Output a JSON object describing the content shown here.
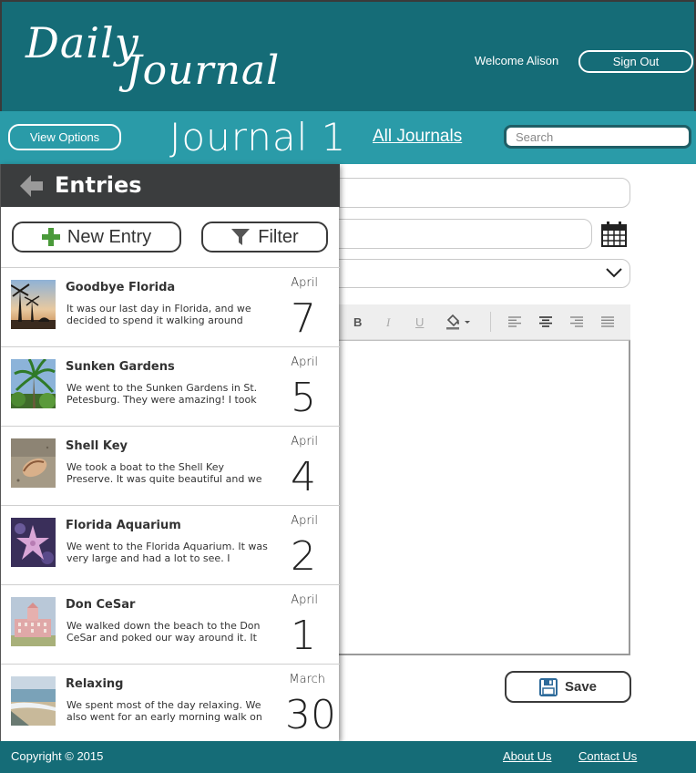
{
  "header": {
    "logo_line1": "Daily",
    "logo_line2": "Journal",
    "welcome": "Welcome Alison",
    "sign_out": "Sign Out"
  },
  "subbar": {
    "view_options": "View Options",
    "journal_title": "Journal 1",
    "all_journals": "All Journals",
    "search_placeholder": "Search"
  },
  "panel": {
    "title": "Entries",
    "new_entry": "New Entry",
    "filter": "Filter"
  },
  "entries": [
    {
      "title": "Goodbye Florida",
      "text": "It was our last day in Florida, and we decided to spend it walking around",
      "month": "April",
      "day": "7",
      "thumb": "palm-sunset"
    },
    {
      "title": "Sunken Gardens",
      "text": "We went to the Sunken Gardens in St. Petesburg. They were amazing! I took",
      "month": "April",
      "day": "5",
      "thumb": "palm-garden"
    },
    {
      "title": "Shell Key",
      "text": "We took a boat to the Shell Key Preserve. It was quite beautiful and we",
      "month": "April",
      "day": "4",
      "thumb": "shell-sand"
    },
    {
      "title": "Florida Aquarium",
      "text": "We went to the Florida Aquarium. It was very large and had a lot to see. I",
      "month": "April",
      "day": "2",
      "thumb": "starfish"
    },
    {
      "title": "Don CeSar",
      "text": "We walked down the beach to the Don CeSar and poked our way around it. It",
      "month": "April",
      "day": "1",
      "thumb": "pink-hotel"
    },
    {
      "title": "Relaxing",
      "text": "We spent most of the day relaxing. We also went for an early morning walk on",
      "month": "March",
      "day": "30",
      "thumb": "beach-shore"
    }
  ],
  "editor": {
    "toolbar": {
      "bold": "B",
      "italic": "I",
      "underline": "U"
    },
    "save": "Save"
  },
  "footer": {
    "copyright": "Copyright © 2015",
    "about": "About Us",
    "contact": "Contact Us"
  },
  "colors": {
    "header_bg": "#156c77",
    "subbar_bg": "#2a9ba8",
    "panel_head_bg": "#3b3d3e",
    "plus_green": "#4a9a3a"
  },
  "icons": [
    "back-arrow-icon",
    "plus-icon",
    "filter-funnel-icon",
    "calendar-icon",
    "chevron-down-icon",
    "paint-bucket-icon",
    "align-left-icon",
    "align-center-icon",
    "align-right-icon",
    "justify-icon",
    "floppy-disk-icon"
  ]
}
